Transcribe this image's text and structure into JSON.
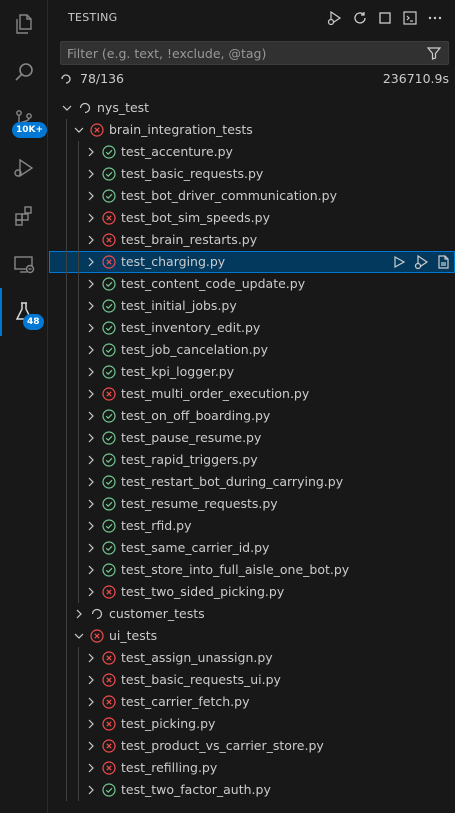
{
  "activity_bar": {
    "items": [
      {
        "name": "explorer-icon",
        "badge": ""
      },
      {
        "name": "search-icon",
        "badge": ""
      },
      {
        "name": "source-control-icon",
        "badge": "10K+"
      },
      {
        "name": "run-debug-icon",
        "badge": ""
      },
      {
        "name": "extensions-icon",
        "badge": ""
      },
      {
        "name": "remote-explorer-icon",
        "badge": ""
      },
      {
        "name": "testing-icon",
        "badge": "48"
      }
    ]
  },
  "panel": {
    "title": "TESTING",
    "filter": {
      "placeholder": "Filter (e.g. text, !exclude, @tag)",
      "value": ""
    },
    "status": {
      "count": "78/136",
      "time": "236710.9s"
    }
  },
  "colors": {
    "pass": "#73c991",
    "fail": "#f14c4c",
    "accent": "#0078d4",
    "selected_bg": "#04395e"
  },
  "tree": [
    {
      "label": "nys_test",
      "depth": 0,
      "expanded": true,
      "status": "running",
      "selected": false
    },
    {
      "label": "brain_integration_tests",
      "depth": 1,
      "expanded": true,
      "status": "fail",
      "selected": false
    },
    {
      "label": "test_accenture.py",
      "depth": 2,
      "expanded": false,
      "status": "pass",
      "selected": false
    },
    {
      "label": "test_basic_requests.py",
      "depth": 2,
      "expanded": false,
      "status": "pass",
      "selected": false
    },
    {
      "label": "test_bot_driver_communication.py",
      "depth": 2,
      "expanded": false,
      "status": "pass",
      "selected": false
    },
    {
      "label": "test_bot_sim_speeds.py",
      "depth": 2,
      "expanded": false,
      "status": "fail",
      "selected": false
    },
    {
      "label": "test_brain_restarts.py",
      "depth": 2,
      "expanded": false,
      "status": "fail",
      "selected": false
    },
    {
      "label": "test_charging.py",
      "depth": 2,
      "expanded": false,
      "status": "fail",
      "selected": true
    },
    {
      "label": "test_content_code_update.py",
      "depth": 2,
      "expanded": false,
      "status": "pass",
      "selected": false
    },
    {
      "label": "test_initial_jobs.py",
      "depth": 2,
      "expanded": false,
      "status": "pass",
      "selected": false
    },
    {
      "label": "test_inventory_edit.py",
      "depth": 2,
      "expanded": false,
      "status": "pass",
      "selected": false
    },
    {
      "label": "test_job_cancelation.py",
      "depth": 2,
      "expanded": false,
      "status": "pass",
      "selected": false
    },
    {
      "label": "test_kpi_logger.py",
      "depth": 2,
      "expanded": false,
      "status": "pass",
      "selected": false
    },
    {
      "label": "test_multi_order_execution.py",
      "depth": 2,
      "expanded": false,
      "status": "fail",
      "selected": false
    },
    {
      "label": "test_on_off_boarding.py",
      "depth": 2,
      "expanded": false,
      "status": "pass",
      "selected": false
    },
    {
      "label": "test_pause_resume.py",
      "depth": 2,
      "expanded": false,
      "status": "pass",
      "selected": false
    },
    {
      "label": "test_rapid_triggers.py",
      "depth": 2,
      "expanded": false,
      "status": "pass",
      "selected": false
    },
    {
      "label": "test_restart_bot_during_carrying.py",
      "depth": 2,
      "expanded": false,
      "status": "pass",
      "selected": false
    },
    {
      "label": "test_resume_requests.py",
      "depth": 2,
      "expanded": false,
      "status": "pass",
      "selected": false
    },
    {
      "label": "test_rfid.py",
      "depth": 2,
      "expanded": false,
      "status": "pass",
      "selected": false
    },
    {
      "label": "test_same_carrier_id.py",
      "depth": 2,
      "expanded": false,
      "status": "pass",
      "selected": false
    },
    {
      "label": "test_store_into_full_aisle_one_bot.py",
      "depth": 2,
      "expanded": false,
      "status": "pass",
      "selected": false
    },
    {
      "label": "test_two_sided_picking.py",
      "depth": 2,
      "expanded": false,
      "status": "fail",
      "selected": false
    },
    {
      "label": "customer_tests",
      "depth": 1,
      "expanded": false,
      "status": "running",
      "selected": false
    },
    {
      "label": "ui_tests",
      "depth": 1,
      "expanded": true,
      "status": "fail",
      "selected": false
    },
    {
      "label": "test_assign_unassign.py",
      "depth": 2,
      "expanded": false,
      "status": "fail",
      "selected": false
    },
    {
      "label": "test_basic_requests_ui.py",
      "depth": 2,
      "expanded": false,
      "status": "fail",
      "selected": false
    },
    {
      "label": "test_carrier_fetch.py",
      "depth": 2,
      "expanded": false,
      "status": "fail",
      "selected": false
    },
    {
      "label": "test_picking.py",
      "depth": 2,
      "expanded": false,
      "status": "fail",
      "selected": false
    },
    {
      "label": "test_product_vs_carrier_store.py",
      "depth": 2,
      "expanded": false,
      "status": "fail",
      "selected": false
    },
    {
      "label": "test_refilling.py",
      "depth": 2,
      "expanded": false,
      "status": "fail",
      "selected": false
    },
    {
      "label": "test_two_factor_auth.py",
      "depth": 2,
      "expanded": false,
      "status": "pass",
      "selected": false
    }
  ]
}
